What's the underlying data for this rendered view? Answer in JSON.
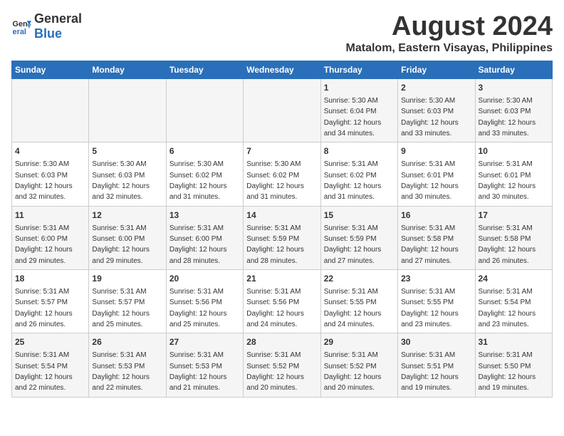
{
  "header": {
    "logo_general": "General",
    "logo_blue": "Blue",
    "main_title": "August 2024",
    "subtitle": "Matalom, Eastern Visayas, Philippines"
  },
  "days_of_week": [
    "Sunday",
    "Monday",
    "Tuesday",
    "Wednesday",
    "Thursday",
    "Friday",
    "Saturday"
  ],
  "weeks": [
    [
      {
        "day": "",
        "info": ""
      },
      {
        "day": "",
        "info": ""
      },
      {
        "day": "",
        "info": ""
      },
      {
        "day": "",
        "info": ""
      },
      {
        "day": "1",
        "info": "Sunrise: 5:30 AM\nSunset: 6:04 PM\nDaylight: 12 hours\nand 34 minutes."
      },
      {
        "day": "2",
        "info": "Sunrise: 5:30 AM\nSunset: 6:03 PM\nDaylight: 12 hours\nand 33 minutes."
      },
      {
        "day": "3",
        "info": "Sunrise: 5:30 AM\nSunset: 6:03 PM\nDaylight: 12 hours\nand 33 minutes."
      }
    ],
    [
      {
        "day": "4",
        "info": "Sunrise: 5:30 AM\nSunset: 6:03 PM\nDaylight: 12 hours\nand 32 minutes."
      },
      {
        "day": "5",
        "info": "Sunrise: 5:30 AM\nSunset: 6:03 PM\nDaylight: 12 hours\nand 32 minutes."
      },
      {
        "day": "6",
        "info": "Sunrise: 5:30 AM\nSunset: 6:02 PM\nDaylight: 12 hours\nand 31 minutes."
      },
      {
        "day": "7",
        "info": "Sunrise: 5:30 AM\nSunset: 6:02 PM\nDaylight: 12 hours\nand 31 minutes."
      },
      {
        "day": "8",
        "info": "Sunrise: 5:31 AM\nSunset: 6:02 PM\nDaylight: 12 hours\nand 31 minutes."
      },
      {
        "day": "9",
        "info": "Sunrise: 5:31 AM\nSunset: 6:01 PM\nDaylight: 12 hours\nand 30 minutes."
      },
      {
        "day": "10",
        "info": "Sunrise: 5:31 AM\nSunset: 6:01 PM\nDaylight: 12 hours\nand 30 minutes."
      }
    ],
    [
      {
        "day": "11",
        "info": "Sunrise: 5:31 AM\nSunset: 6:00 PM\nDaylight: 12 hours\nand 29 minutes."
      },
      {
        "day": "12",
        "info": "Sunrise: 5:31 AM\nSunset: 6:00 PM\nDaylight: 12 hours\nand 29 minutes."
      },
      {
        "day": "13",
        "info": "Sunrise: 5:31 AM\nSunset: 6:00 PM\nDaylight: 12 hours\nand 28 minutes."
      },
      {
        "day": "14",
        "info": "Sunrise: 5:31 AM\nSunset: 5:59 PM\nDaylight: 12 hours\nand 28 minutes."
      },
      {
        "day": "15",
        "info": "Sunrise: 5:31 AM\nSunset: 5:59 PM\nDaylight: 12 hours\nand 27 minutes."
      },
      {
        "day": "16",
        "info": "Sunrise: 5:31 AM\nSunset: 5:58 PM\nDaylight: 12 hours\nand 27 minutes."
      },
      {
        "day": "17",
        "info": "Sunrise: 5:31 AM\nSunset: 5:58 PM\nDaylight: 12 hours\nand 26 minutes."
      }
    ],
    [
      {
        "day": "18",
        "info": "Sunrise: 5:31 AM\nSunset: 5:57 PM\nDaylight: 12 hours\nand 26 minutes."
      },
      {
        "day": "19",
        "info": "Sunrise: 5:31 AM\nSunset: 5:57 PM\nDaylight: 12 hours\nand 25 minutes."
      },
      {
        "day": "20",
        "info": "Sunrise: 5:31 AM\nSunset: 5:56 PM\nDaylight: 12 hours\nand 25 minutes."
      },
      {
        "day": "21",
        "info": "Sunrise: 5:31 AM\nSunset: 5:56 PM\nDaylight: 12 hours\nand 24 minutes."
      },
      {
        "day": "22",
        "info": "Sunrise: 5:31 AM\nSunset: 5:55 PM\nDaylight: 12 hours\nand 24 minutes."
      },
      {
        "day": "23",
        "info": "Sunrise: 5:31 AM\nSunset: 5:55 PM\nDaylight: 12 hours\nand 23 minutes."
      },
      {
        "day": "24",
        "info": "Sunrise: 5:31 AM\nSunset: 5:54 PM\nDaylight: 12 hours\nand 23 minutes."
      }
    ],
    [
      {
        "day": "25",
        "info": "Sunrise: 5:31 AM\nSunset: 5:54 PM\nDaylight: 12 hours\nand 22 minutes."
      },
      {
        "day": "26",
        "info": "Sunrise: 5:31 AM\nSunset: 5:53 PM\nDaylight: 12 hours\nand 22 minutes."
      },
      {
        "day": "27",
        "info": "Sunrise: 5:31 AM\nSunset: 5:53 PM\nDaylight: 12 hours\nand 21 minutes."
      },
      {
        "day": "28",
        "info": "Sunrise: 5:31 AM\nSunset: 5:52 PM\nDaylight: 12 hours\nand 20 minutes."
      },
      {
        "day": "29",
        "info": "Sunrise: 5:31 AM\nSunset: 5:52 PM\nDaylight: 12 hours\nand 20 minutes."
      },
      {
        "day": "30",
        "info": "Sunrise: 5:31 AM\nSunset: 5:51 PM\nDaylight: 12 hours\nand 19 minutes."
      },
      {
        "day": "31",
        "info": "Sunrise: 5:31 AM\nSunset: 5:50 PM\nDaylight: 12 hours\nand 19 minutes."
      }
    ]
  ]
}
